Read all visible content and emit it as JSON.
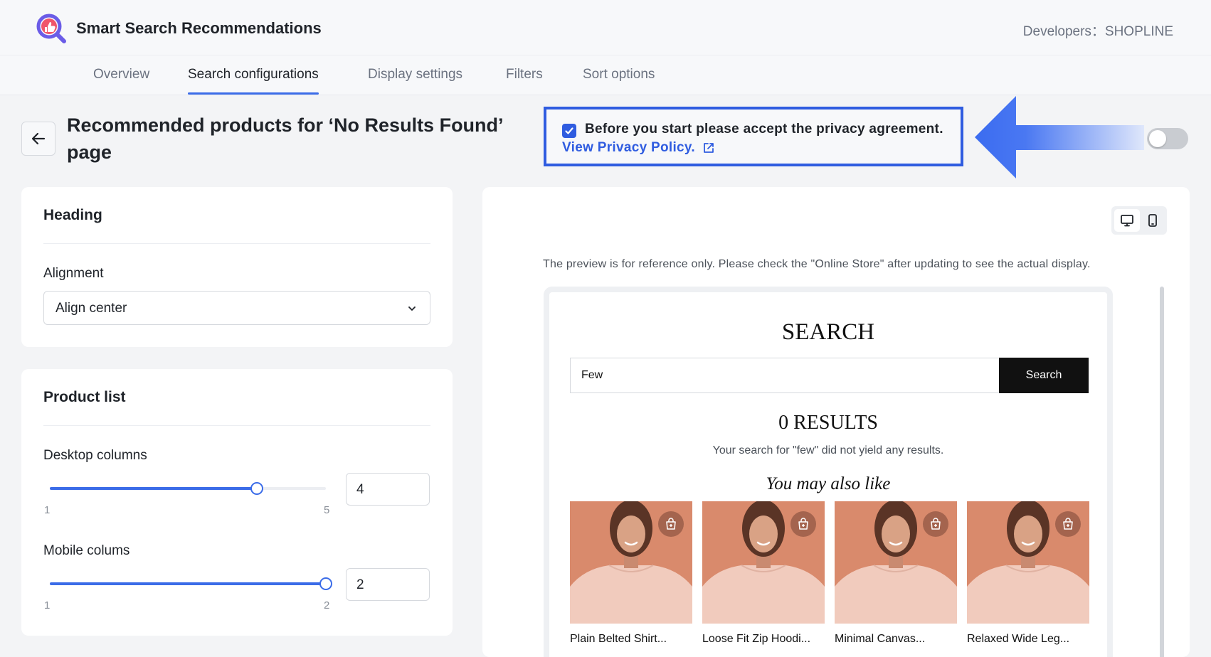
{
  "app": {
    "title": "Smart Search Recommendations",
    "developers_label": "Developers：",
    "developers_value": "SHOPLINE",
    "logo_icon": "magnifier-thumbs-up-logo-icon"
  },
  "tabs": [
    {
      "label": "Overview",
      "active": false
    },
    {
      "label": "Search configurations",
      "active": true
    },
    {
      "label": "Display settings",
      "active": false
    },
    {
      "label": "Filters",
      "active": false
    },
    {
      "label": "Sort options",
      "active": false
    }
  ],
  "page": {
    "title": "Recommended products for ‘No Results Found’ page",
    "back_icon": "arrow-left-icon"
  },
  "privacy": {
    "checked": true,
    "text": "Before you start please accept the privacy agreement.",
    "link": "View Privacy Policy.",
    "link_icon": "external-link-icon",
    "toggle_on": false
  },
  "heading_card": {
    "title": "Heading",
    "alignment_label": "Alignment",
    "alignment_value": "Align center"
  },
  "product_list_card": {
    "title": "Product list",
    "desktop": {
      "label": "Desktop columns",
      "min": "1",
      "max": "5",
      "value": "4",
      "fraction": 0.75
    },
    "mobile": {
      "label": "Mobile colums",
      "min": "1",
      "max": "2",
      "value": "2",
      "fraction": 1.0
    }
  },
  "preview": {
    "note": "The preview is for reference only. Please check the \"Online Store\" after updating to see the actual display.",
    "device_icons": [
      "desktop-icon",
      "mobile-icon"
    ],
    "heading": "SEARCH",
    "search_value": "Few",
    "search_button": "Search",
    "results_title": "0 RESULTS",
    "results_sub": "Your search for \"few\" did not yield any results.",
    "also_like": "You may also like",
    "products": [
      {
        "name": "Plain Belted Shirt..."
      },
      {
        "name": "Loose Fit Zip Hoodi..."
      },
      {
        "name": "Minimal Canvas..."
      },
      {
        "name": "Relaxed Wide Leg..."
      }
    ]
  },
  "colors": {
    "accent": "#3b6ce8",
    "highlight_border": "#2f5ce0",
    "arrow_gradient_start": "#3b6cf0",
    "arrow_gradient_end": "#dfe7fb"
  }
}
